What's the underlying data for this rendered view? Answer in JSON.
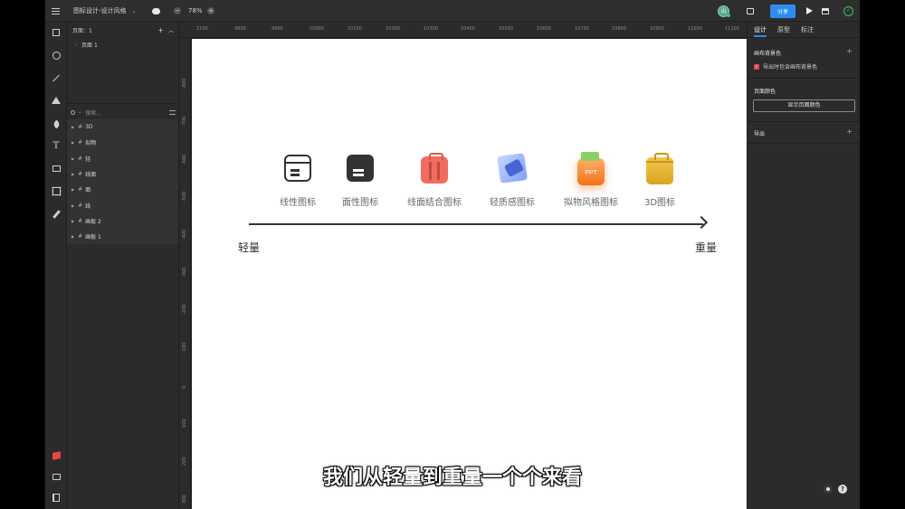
{
  "topbar": {
    "doc_title": "图标设计-设计风格",
    "zoom": "78%",
    "zoom_minus": "−",
    "zoom_plus": "+",
    "avatar_initial": "山",
    "share_label": "分享"
  },
  "pages": {
    "header": "页面：1",
    "items": [
      {
        "label": "页面 1"
      }
    ]
  },
  "layers": {
    "search_placeholder": "搜索...",
    "items": [
      {
        "label": "3D"
      },
      {
        "label": "拟物"
      },
      {
        "label": "轻"
      },
      {
        "label": "线面"
      },
      {
        "label": "面"
      },
      {
        "label": "线"
      },
      {
        "label": "画板 2"
      },
      {
        "label": "画板 1"
      }
    ]
  },
  "ruler": {
    "top": [
      "1100",
      "9800",
      "9900",
      "10000",
      "10100",
      "10200",
      "10300",
      "10400",
      "10500",
      "10600",
      "10700",
      "10800",
      "10900",
      "11000",
      "11100"
    ],
    "left": [
      "-800",
      "-700",
      "-600",
      "-500",
      "-400",
      "-300",
      "-200",
      "-100",
      "0",
      "100",
      "200",
      "300"
    ]
  },
  "canvas": {
    "icons": [
      {
        "label": "线性图标",
        "icon": "outline-card-icon"
      },
      {
        "label": "面性图标",
        "icon": "filled-card-icon"
      },
      {
        "label": "线面结合图标",
        "icon": "luggage-icon"
      },
      {
        "label": "轻质感图标",
        "icon": "light-card-icon"
      },
      {
        "label": "拟物风格图标",
        "icon": "ppt-folder-icon",
        "badge": "PPT"
      },
      {
        "label": "3D图标",
        "icon": "3d-suitcase-icon"
      }
    ],
    "axis_left": "轻量",
    "axis_right": "重量"
  },
  "right_panel": {
    "tabs": [
      {
        "label": "设计"
      },
      {
        "label": "原型"
      },
      {
        "label": "标注"
      }
    ],
    "canvas_bg_title": "画布背景色",
    "export_bg_label": "导出时包含画布背景色",
    "page_color_title": "页面颜色",
    "show_page_color_btn": "显示页面颜色",
    "export_title": "导出"
  },
  "subtitle": "我们从轻量到重量一个个来看",
  "colors": {
    "accent": "#2d8cf0",
    "danger": "#e6454a",
    "ok": "#3fbf6f"
  }
}
